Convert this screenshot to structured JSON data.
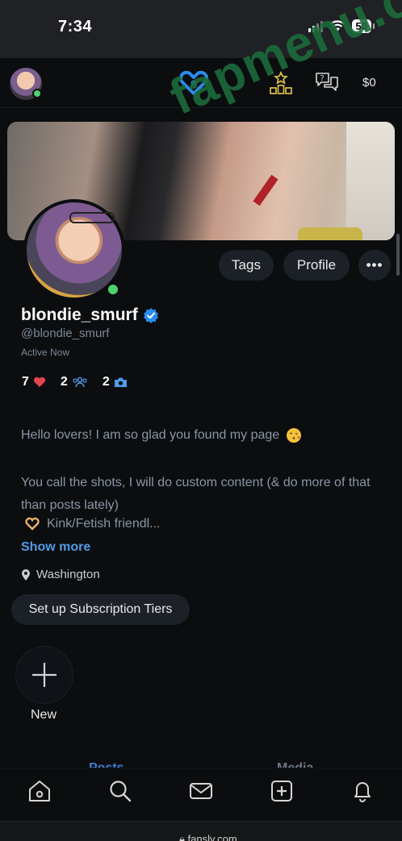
{
  "status_bar": {
    "time": "7:34",
    "battery": "50"
  },
  "nav": {
    "balance": "$0"
  },
  "watermark": "fapmenu.com",
  "profile": {
    "username": "blondie_smurf",
    "handle": "@blondie_smurf",
    "status": "Active Now",
    "buttons": {
      "tags": "Tags",
      "profile": "Profile",
      "more": "•••"
    },
    "stats": {
      "likes": "7",
      "subscribers": "2",
      "photos": "2"
    },
    "bio": {
      "line1": "Hello lovers! I am so glad you found my page",
      "line2": "You call the shots, I will do custom content (& do more of that than posts lately)",
      "line3": "Kink/Fetish friendl...",
      "show_more": "Show more"
    },
    "location": "Washington",
    "subscription_button": "Set up Subscription Tiers"
  },
  "stories": {
    "new_label": "New"
  },
  "tabs": {
    "posts": "Posts",
    "media": "Media"
  },
  "browser": {
    "url": "fansly.com"
  },
  "colors": {
    "accent": "#2a8cf0",
    "online": "#4cd36d",
    "link": "#4f9ce8",
    "like": "#e0454f"
  }
}
